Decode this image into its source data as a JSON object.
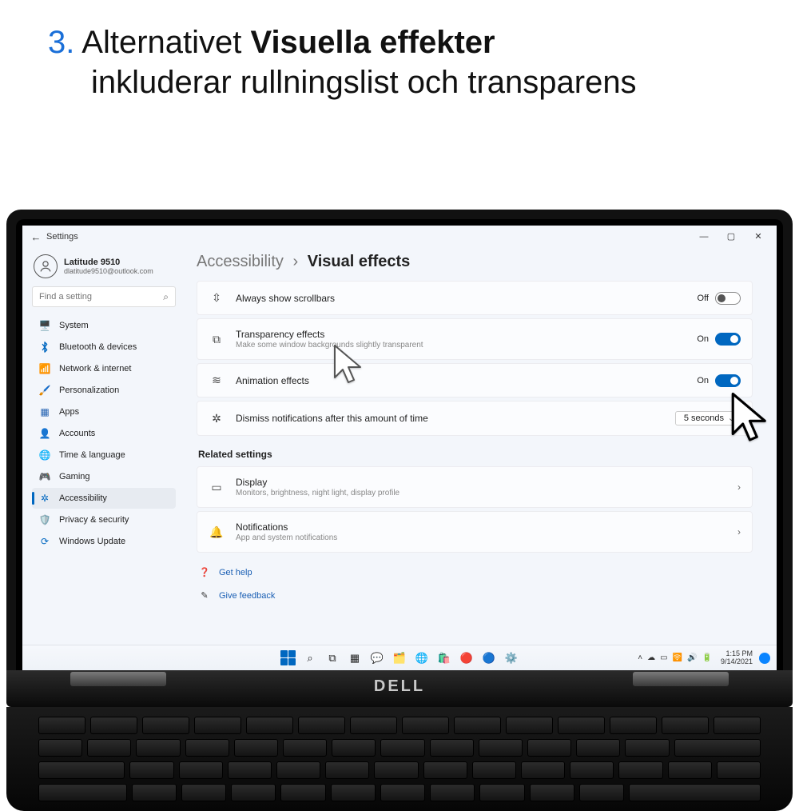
{
  "instruction": {
    "number": "3.",
    "prefix": "Alternativet ",
    "bold": "Visuella effekter",
    "suffix": " inkluderar rullningslist och transparens"
  },
  "laptop_brand": "DELL",
  "window": {
    "title": "Settings",
    "controls": {
      "min": "—",
      "max": "▢",
      "close": "✕"
    }
  },
  "user": {
    "name": "Latitude 9510",
    "email": "dlatitude9510@outlook.com"
  },
  "search": {
    "placeholder": "Find a setting"
  },
  "sidebar": {
    "items": [
      {
        "icon": "🖥️",
        "label": "System",
        "cls": "c-navy"
      },
      {
        "icon": "ᚼ",
        "label": "Bluetooth & devices",
        "cls": "c-blue",
        "isBT": true
      },
      {
        "icon": "📶",
        "label": "Network & internet",
        "cls": "c-cyan"
      },
      {
        "icon": "🖌️",
        "label": "Personalization",
        "cls": "c-purple"
      },
      {
        "icon": "▦",
        "label": "Apps",
        "cls": "c-navy"
      },
      {
        "icon": "👤",
        "label": "Accounts",
        "cls": "c-green"
      },
      {
        "icon": "🌐",
        "label": "Time & language",
        "cls": "c-cyan"
      },
      {
        "icon": "🎮",
        "label": "Gaming",
        "cls": "c-gray"
      },
      {
        "icon": "✲",
        "label": "Accessibility",
        "cls": "c-blue",
        "active": true
      },
      {
        "icon": "🛡️",
        "label": "Privacy & security",
        "cls": "c-gray"
      },
      {
        "icon": "⟳",
        "label": "Windows Update",
        "cls": "c-blue"
      }
    ]
  },
  "breadcrumb": {
    "parent": "Accessibility",
    "sep": "›",
    "current": "Visual effects"
  },
  "settings": [
    {
      "icon": "⇳",
      "title": "Always show scrollbars",
      "sub": "",
      "state": "Off",
      "on": false,
      "type": "toggle"
    },
    {
      "icon": "⧉",
      "title": "Transparency effects",
      "sub": "Make some window backgrounds slightly transparent",
      "state": "On",
      "on": true,
      "type": "toggle"
    },
    {
      "icon": "≋",
      "title": "Animation effects",
      "sub": "",
      "state": "On",
      "on": true,
      "type": "toggle"
    },
    {
      "icon": "✲",
      "title": "Dismiss notifications after this amount of time",
      "sub": "",
      "value": "5 seconds",
      "type": "dropdown"
    }
  ],
  "related": {
    "heading": "Related settings",
    "items": [
      {
        "icon": "▭",
        "title": "Display",
        "sub": "Monitors, brightness, night light, display profile"
      },
      {
        "icon": "🔔",
        "title": "Notifications",
        "sub": "App and system notifications"
      }
    ]
  },
  "help_links": [
    {
      "icon": "❓",
      "label": "Get help"
    },
    {
      "icon": "✎",
      "label": "Give feedback"
    }
  ],
  "taskbar": {
    "icons": [
      "start",
      "search",
      "taskview",
      "widgets",
      "chat",
      "explorer",
      "edge",
      "store",
      "a",
      "b",
      "settings"
    ],
    "tray": [
      "˄",
      "☁",
      "▭",
      "🛜",
      "🔊",
      "🔋"
    ],
    "time": "1:15 PM",
    "date": "9/14/2021"
  }
}
